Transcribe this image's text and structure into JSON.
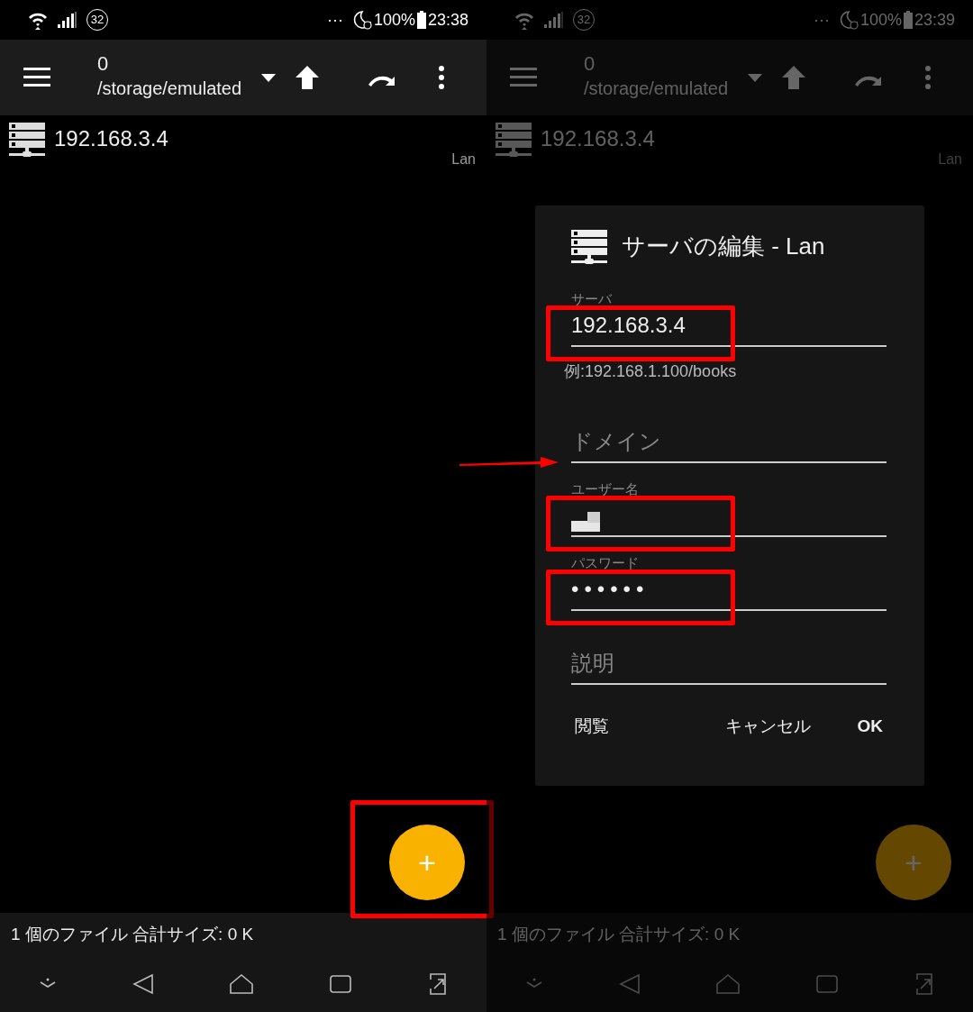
{
  "screens": [
    {
      "dimmed": false,
      "status_bar": {
        "notification_count": "32",
        "overflow": "···",
        "battery": "100%",
        "time": "23:38"
      },
      "toolbar": {
        "title": "0",
        "path": "/storage/emulated"
      },
      "servers": [
        {
          "address": "192.168.3.4",
          "type": "Lan"
        }
      ],
      "fab": {
        "label": "+",
        "highlighted": true
      },
      "footer": "1 個のファイル 合計サイズ: 0 K"
    },
    {
      "dimmed": true,
      "status_bar": {
        "notification_count": "32",
        "overflow": "···",
        "battery": "100%",
        "time": "23:39"
      },
      "toolbar": {
        "title": "0",
        "path": "/storage/emulated"
      },
      "servers": [
        {
          "address": "192.168.3.4",
          "type": "Lan"
        }
      ],
      "fab": {
        "label": "+",
        "highlighted": false
      },
      "footer": "1 個のファイル 合計サイズ: 0 K",
      "dialog": {
        "title": "サーバの編集 - Lan",
        "fields": [
          {
            "kind": "text",
            "label": "サーバ",
            "value": "192.168.3.4",
            "helper": "例:192.168.1.100/books",
            "highlighted": true,
            "pointed": false
          },
          {
            "kind": "text",
            "placeholder": "ドメイン",
            "highlighted": false,
            "pointed": true
          },
          {
            "kind": "redacted",
            "label": "ユーザー名",
            "highlighted": true,
            "pointed": false
          },
          {
            "kind": "text",
            "label": "パスワード",
            "value": "••••••",
            "highlighted": true,
            "pointed": false
          },
          {
            "kind": "text",
            "placeholder": "説明",
            "highlighted": false,
            "pointed": false
          }
        ],
        "buttons": [
          "閲覧",
          "キャンセル",
          "OK"
        ]
      }
    }
  ]
}
